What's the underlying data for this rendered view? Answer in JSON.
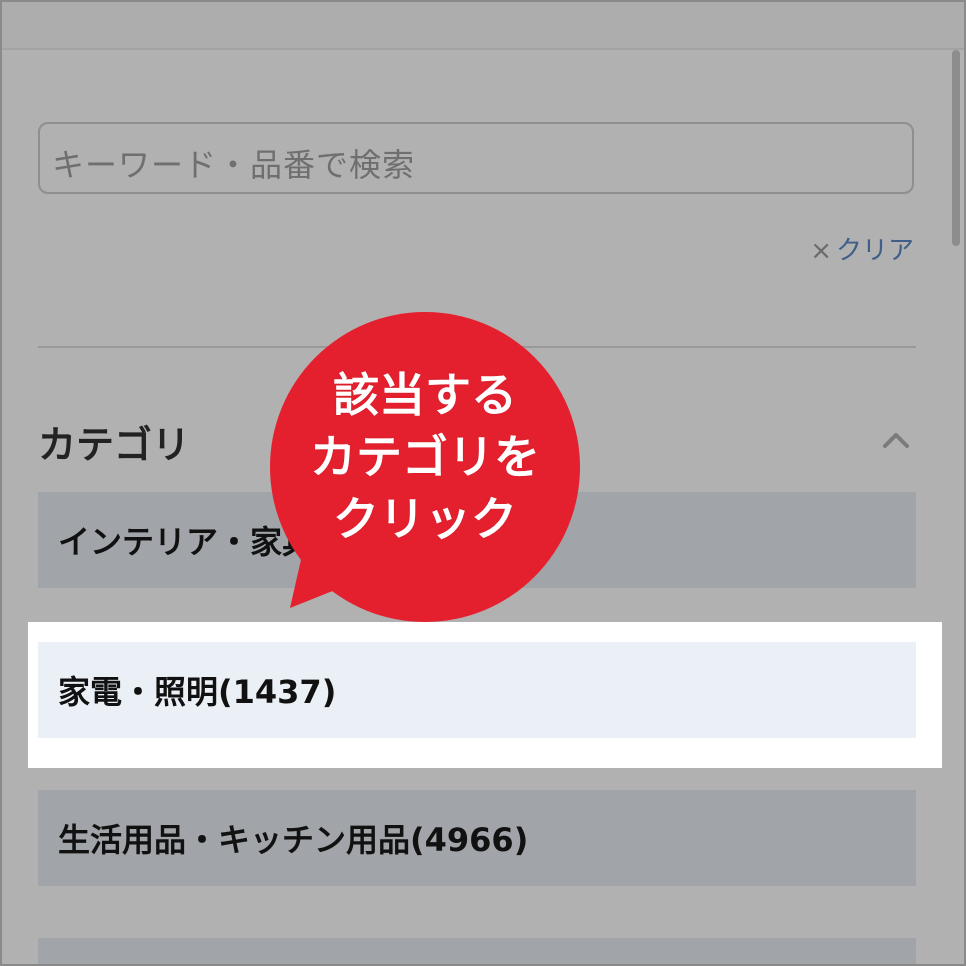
{
  "search": {
    "placeholder": "キーワード・品番で検索"
  },
  "clear": {
    "icon": "close-icon",
    "label": "クリア"
  },
  "category": {
    "title": "カテゴリ",
    "chevron_icon": "chevron-up-icon",
    "items": [
      {
        "label": "インテリア・家具(8304)"
      },
      {
        "label": "家電・照明(1437)"
      },
      {
        "label": "生活用品・キッチン用品(4966)"
      },
      {
        "label": ""
      }
    ]
  },
  "callout": {
    "lines": [
      "該当する",
      "カテゴリを",
      "クリック"
    ],
    "color": "#e5202e"
  },
  "colors": {
    "overlay_gray": "#b1b1b1",
    "item_gray": "#a1a4a9",
    "highlight_item": "#ebf0f6",
    "link_blue": "#3f5f88"
  }
}
